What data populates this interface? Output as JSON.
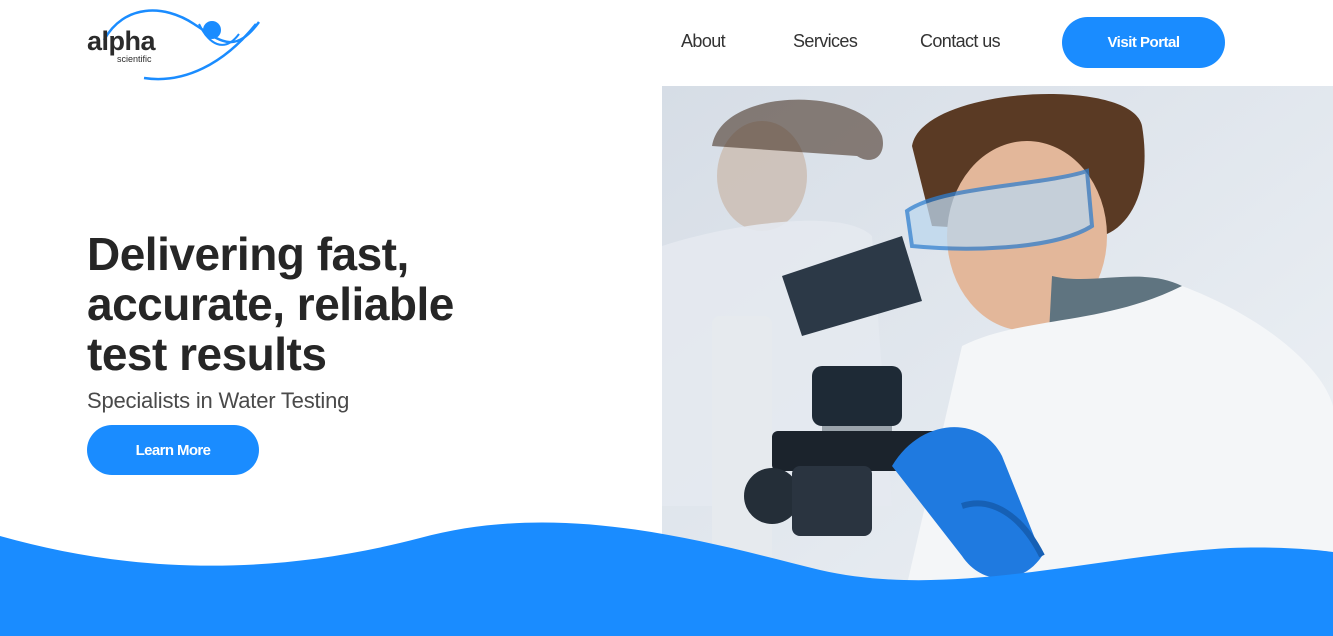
{
  "brand": {
    "name": "alpha",
    "tagline": "scientific",
    "color": "#1a8cff"
  },
  "nav": {
    "items": [
      {
        "label": "About"
      },
      {
        "label": "Services"
      },
      {
        "label": "Contact us"
      }
    ],
    "portal_label": "Visit Portal"
  },
  "hero": {
    "title_lines": [
      "Delivering fast,",
      "accurate, reliable",
      "test results"
    ],
    "subtitle": "Specialists in Water Testing",
    "cta_label": "Learn More"
  },
  "colors": {
    "accent": "#1a8cff",
    "text": "#262626",
    "background": "#ffffff"
  }
}
